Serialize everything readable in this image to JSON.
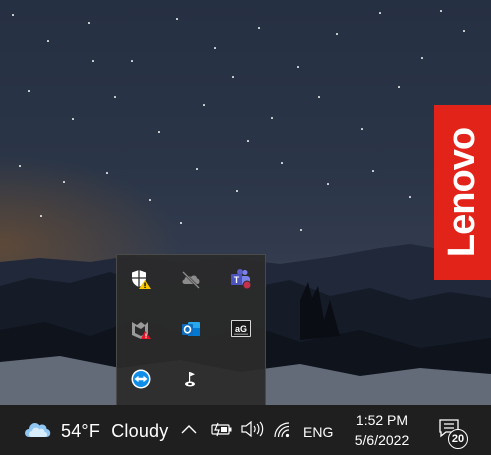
{
  "desktop": {
    "brand_tag": "Lenovo"
  },
  "tray_overflow": {
    "icons": [
      {
        "name": "windows-security-warning-icon"
      },
      {
        "name": "onedrive-offline-icon"
      },
      {
        "name": "microsoft-teams-icon"
      },
      {
        "name": "mcafee-alert-icon"
      },
      {
        "name": "outlook-icon"
      },
      {
        "name": "ag-app-icon",
        "label": "aG"
      },
      {
        "name": "teamviewer-icon"
      },
      {
        "name": "pointer-flag-icon"
      }
    ]
  },
  "taskbar": {
    "weather": {
      "temperature": "54°F",
      "condition": "Cloudy"
    },
    "language": "ENG",
    "clock": {
      "time": "1:52 PM",
      "date": "5/6/2022"
    },
    "notifications": {
      "count": "20"
    }
  },
  "colors": {
    "lenovo_red": "#e2231a",
    "taskbar": "#1f1f1f",
    "popup": "#2b2b2b",
    "outlook_blue": "#0f6cbd",
    "teams_purple": "#5b5fc7",
    "teamviewer_blue": "#0e8ee9",
    "security_warning": "#f7c600"
  }
}
